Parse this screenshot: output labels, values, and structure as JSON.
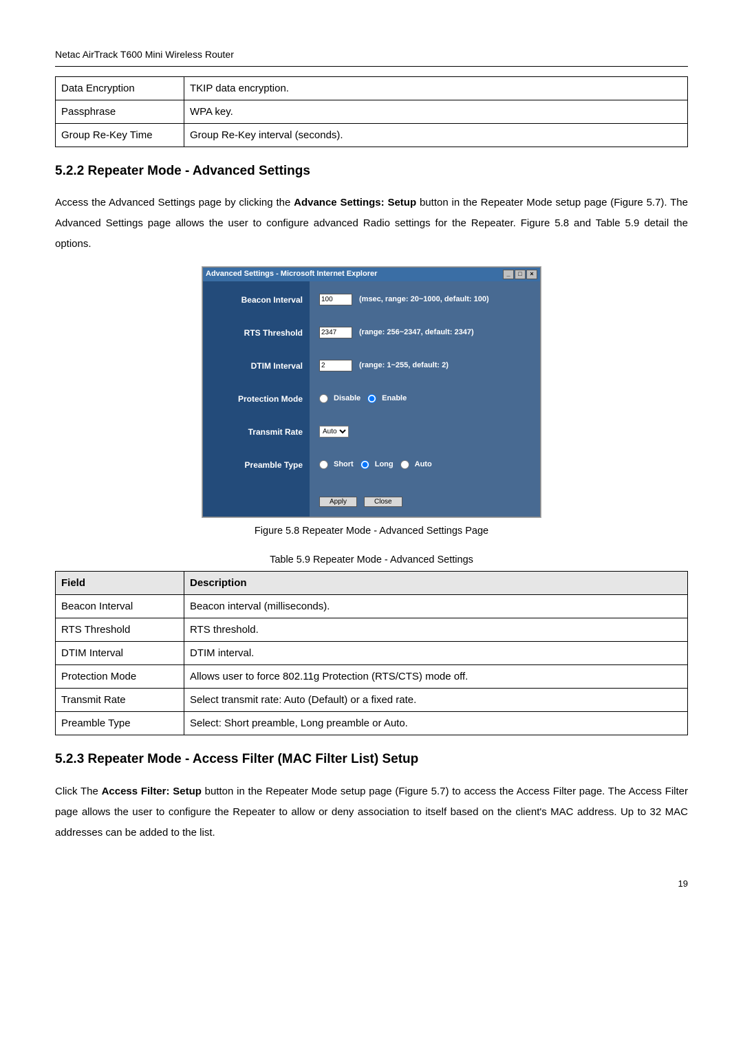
{
  "header": "Netac AirTrack T600 Mini Wireless Router",
  "table1": {
    "rows": [
      {
        "field": "Data Encryption",
        "desc": "TKIP data encryption."
      },
      {
        "field": "Passphrase",
        "desc": "WPA key."
      },
      {
        "field": "Group Re-Key Time",
        "desc": "Group Re-Key interval (seconds)."
      }
    ]
  },
  "section522": {
    "heading": "5.2.2 Repeater Mode - Advanced Settings",
    "para_pre": "Access the Advanced Settings page by clicking the ",
    "para_bold": "Advance Settings: Setup",
    "para_post": " button in the Repeater Mode setup page (Figure 5.7). The Advanced Settings page allows the user to configure advanced Radio settings for the Repeater. Figure 5.8 and Table 5.9 detail the options."
  },
  "screenshot": {
    "title": "Advanced Settings - Microsoft Internet Explorer",
    "min": "_",
    "max": "□",
    "close": "×",
    "labels": {
      "beacon": "Beacon Interval",
      "rts": "RTS Threshold",
      "dtim": "DTIM Interval",
      "protection": "Protection Mode",
      "transmit": "Transmit Rate",
      "preamble": "Preamble Type"
    },
    "values": {
      "beacon": "100",
      "beacon_hint": "(msec, range: 20~1000, default: 100)",
      "rts": "2347",
      "rts_hint": "(range: 256~2347, default: 2347)",
      "dtim": "2",
      "dtim_hint": "(range: 1~255, default: 2)",
      "protection_disable": "Disable",
      "protection_enable": "Enable",
      "transmit_option": "Auto",
      "preamble_short": "Short",
      "preamble_long": "Long",
      "preamble_auto": "Auto",
      "apply": "Apply",
      "close_btn": "Close"
    }
  },
  "figcaption": "Figure 5.8 Repeater Mode - Advanced Settings Page",
  "table59": {
    "caption": "Table 5.9 Repeater Mode - Advanced Settings",
    "head_field": "Field",
    "head_desc": "Description",
    "rows": [
      {
        "field": "Beacon Interval",
        "desc": "Beacon interval (milliseconds)."
      },
      {
        "field": "RTS Threshold",
        "desc": "RTS threshold."
      },
      {
        "field": "DTIM Interval",
        "desc": "DTIM interval."
      },
      {
        "field": "Protection Mode",
        "desc": "Allows user to force 802.11g Protection (RTS/CTS) mode off."
      },
      {
        "field": "Transmit Rate",
        "desc": "Select transmit rate: Auto (Default) or a fixed rate."
      },
      {
        "field": "Preamble Type",
        "desc": "Select: Short preamble, Long preamble or Auto."
      }
    ]
  },
  "section523": {
    "heading": "5.2.3 Repeater Mode - Access Filter (MAC Filter List) Setup",
    "para_pre": "Click The ",
    "para_bold": "Access Filter: Setup",
    "para_post": " button in the Repeater Mode setup page (Figure 5.7) to access the Access Filter page. The Access Filter page allows the user to configure the Repeater to allow or deny association to itself based on the client's MAC address. Up to 32 MAC addresses can be added to the list."
  },
  "page_number": "19"
}
